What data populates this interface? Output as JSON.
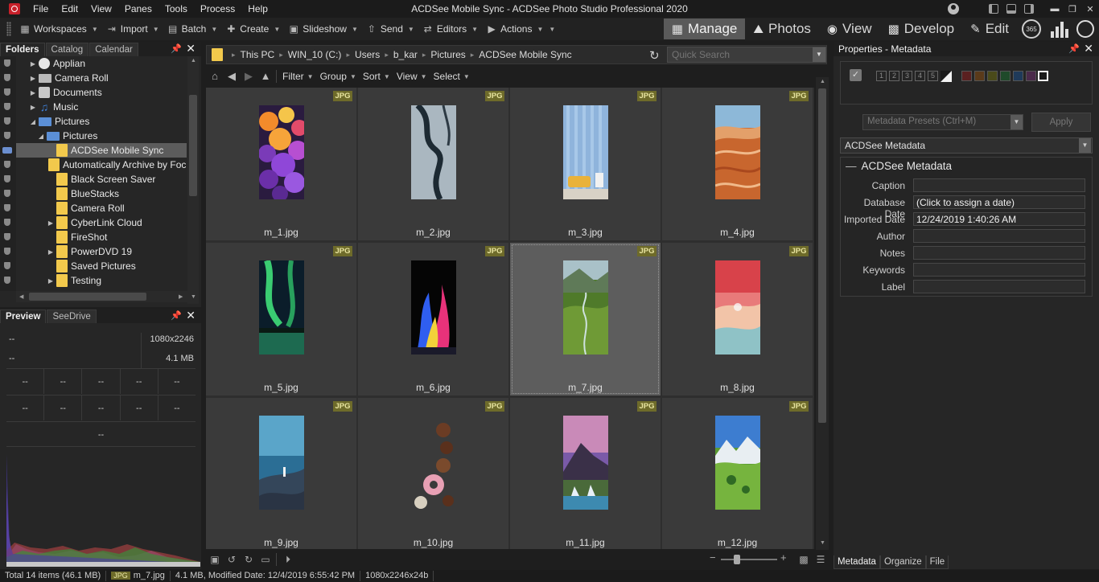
{
  "app": {
    "title": "ACDSee Mobile Sync - ACDSee Photo Studio Professional 2020",
    "menu": [
      "File",
      "Edit",
      "View",
      "Panes",
      "Tools",
      "Process",
      "Help"
    ]
  },
  "toolbar": {
    "workspaces": "Workspaces",
    "import": "Import",
    "batch": "Batch",
    "create": "Create",
    "slideshow": "Slideshow",
    "send": "Send",
    "editors": "Editors",
    "actions": "Actions",
    "modes": {
      "manage": "Manage",
      "photos": "Photos",
      "view": "View",
      "develop": "Develop",
      "edit": "Edit"
    },
    "badge_365": "365"
  },
  "folders_panel": {
    "tabs": [
      "Folders",
      "Catalog",
      "Calendar"
    ],
    "items": [
      {
        "label": "Applian",
        "icon": "applian-icon",
        "expander": "▶"
      },
      {
        "label": "Camera Roll",
        "icon": "folder-icon",
        "expander": "▶"
      },
      {
        "label": "Documents",
        "icon": "documents-icon",
        "expander": "▶"
      },
      {
        "label": "Music",
        "icon": "music-icon",
        "expander": "▶"
      },
      {
        "label": "Pictures",
        "icon": "pictures-icon",
        "expander": "◢"
      },
      {
        "label": "Pictures",
        "icon": "pictures-icon",
        "expander": "◢"
      },
      {
        "label": "ACDSee Mobile Sync",
        "icon": "folder-icon",
        "expander": ""
      },
      {
        "label": "Automatically Archive by Focus",
        "icon": "folder-icon",
        "expander": ""
      },
      {
        "label": "Black Screen Saver",
        "icon": "folder-icon",
        "expander": ""
      },
      {
        "label": "BlueStacks",
        "icon": "folder-icon",
        "expander": ""
      },
      {
        "label": "Camera Roll",
        "icon": "folder-icon",
        "expander": ""
      },
      {
        "label": "CyberLink Cloud",
        "icon": "folder-icon",
        "expander": "▶"
      },
      {
        "label": "FireShot",
        "icon": "folder-icon",
        "expander": ""
      },
      {
        "label": "PowerDVD 19",
        "icon": "folder-icon",
        "expander": "▶"
      },
      {
        "label": "Saved Pictures",
        "icon": "folder-icon",
        "expander": ""
      },
      {
        "label": "Testing",
        "icon": "folder-icon",
        "expander": "▶"
      }
    ]
  },
  "preview_panel": {
    "tabs": [
      "Preview",
      "SeeDrive"
    ],
    "dims": "1080x2246",
    "size": "4.1 MB",
    "placeholder": "--"
  },
  "address_bar": {
    "crumbs": [
      "This PC",
      "WIN_10 (C:)",
      "Users",
      "b_kar",
      "Pictures",
      "ACDSee Mobile Sync"
    ],
    "search_placeholder": "Quick Search"
  },
  "filter_bar": [
    "Filter",
    "Group",
    "Sort",
    "View",
    "Select"
  ],
  "thumbnails": [
    {
      "name": "m_1.jpg",
      "badge": "JPG"
    },
    {
      "name": "m_2.jpg",
      "badge": "JPG"
    },
    {
      "name": "m_3.jpg",
      "badge": "JPG"
    },
    {
      "name": "m_4.jpg",
      "badge": "JPG"
    },
    {
      "name": "m_5.jpg",
      "badge": "JPG"
    },
    {
      "name": "m_6.jpg",
      "badge": "JPG"
    },
    {
      "name": "m_7.jpg",
      "badge": "JPG"
    },
    {
      "name": "m_8.jpg",
      "badge": "JPG"
    },
    {
      "name": "m_9.jpg",
      "badge": "JPG"
    },
    {
      "name": "m_10.jpg",
      "badge": "JPG"
    },
    {
      "name": "m_11.jpg",
      "badge": "JPG"
    },
    {
      "name": "m_12.jpg",
      "badge": "JPG"
    }
  ],
  "properties": {
    "title": "Properties - Metadata",
    "rating_numbers": [
      "1",
      "2",
      "3",
      "4",
      "5"
    ],
    "color_labels": [
      "#5a2020",
      "#5a3a1a",
      "#4a4a1a",
      "#1f4a2a",
      "#1f3a5a",
      "#4a2a4a"
    ],
    "presets_placeholder": "Metadata Presets (Ctrl+M)",
    "apply": "Apply",
    "selected_set": "ACDSee Metadata",
    "group_title": "ACDSee Metadata",
    "fields": [
      {
        "label": "Caption",
        "value": ""
      },
      {
        "label": "Database Date",
        "value": "(Click to assign a date)"
      },
      {
        "label": "Imported Date",
        "value": "12/24/2019 1:40:26 AM"
      },
      {
        "label": "Author",
        "value": ""
      },
      {
        "label": "Notes",
        "value": ""
      },
      {
        "label": "Keywords",
        "value": ""
      },
      {
        "label": "Label",
        "value": ""
      }
    ],
    "bottom_tabs": [
      "Metadata",
      "Organize",
      "File"
    ]
  },
  "statusbar": {
    "total": "Total 14 items  (46.1 MB)",
    "badge": "JPG",
    "filename": "m_7.jpg",
    "details": "4.1 MB, Modified Date: 12/4/2019 6:55:42 PM",
    "resolution": "1080x2246x24b"
  },
  "colors": {
    "jpg_badge": "#6e6b2a",
    "selection": "#5d5d5d",
    "folder": "#f2c94c",
    "active_mode": "#5a5a5a"
  }
}
